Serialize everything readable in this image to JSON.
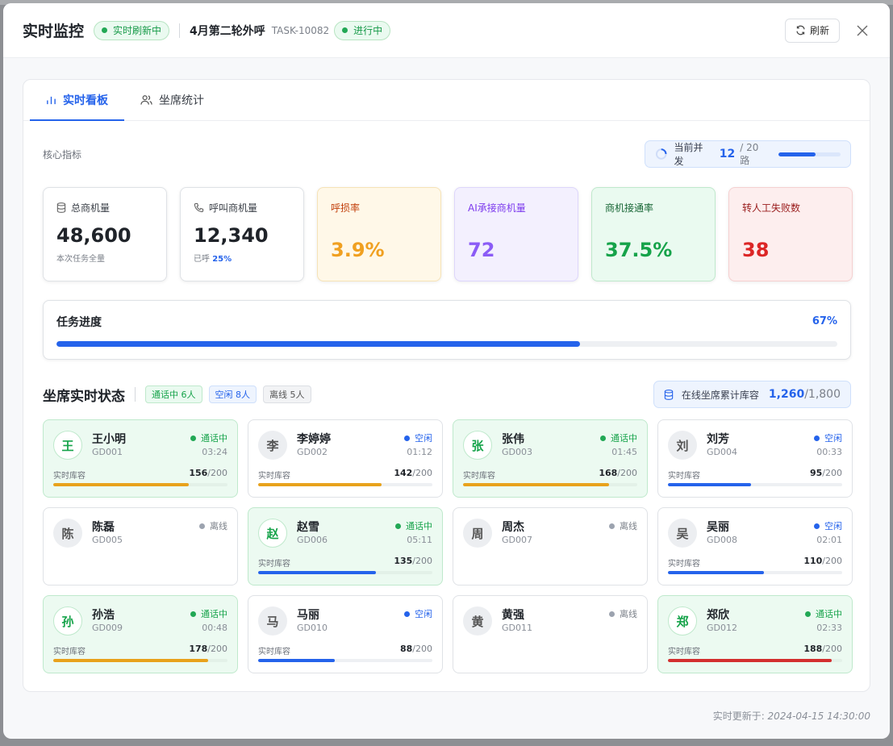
{
  "header": {
    "title": "实时监控",
    "live_pill": "实时刷新中",
    "task_name": "4月第二轮外呼",
    "task_id": "TASK-10082",
    "status_pill": "进行中",
    "refresh_label": "刷新"
  },
  "tabs": [
    {
      "label": "实时看板",
      "icon": "bar-chart-icon",
      "active": true
    },
    {
      "label": "坐席统计",
      "icon": "users-icon",
      "active": false
    }
  ],
  "core": {
    "label": "核心指标",
    "concurrency_label": "当前并发",
    "concurrency_value": "12",
    "concurrency_total": "/ 20 路",
    "concurrency_ratio": 0.6
  },
  "metrics": [
    {
      "label": "总商机量",
      "icon": "database-icon",
      "value": "48,600",
      "sub": "本次任务全量",
      "style": "plain"
    },
    {
      "label": "呼叫商机量",
      "icon": "phone-icon",
      "value": "12,340",
      "sub_prefix": "已呼 ",
      "sub_highlight": "25%",
      "style": "plain"
    },
    {
      "label": "呼损率",
      "value": "3.9%",
      "style": "orange"
    },
    {
      "label": "AI承接商机量",
      "value": "72",
      "style": "purple"
    },
    {
      "label": "商机接通率",
      "value": "37.5%",
      "style": "green"
    },
    {
      "label": "转人工失败数",
      "value": "38",
      "style": "red"
    }
  ],
  "progress": {
    "title": "任务进度",
    "percent_label": "67%",
    "percent": 67
  },
  "agents_section": {
    "title": "坐席实时状态",
    "badges": [
      {
        "text": "通话中 6人",
        "kind": "g"
      },
      {
        "text": "空闲 8人",
        "kind": "b"
      },
      {
        "text": "离线 5人",
        "kind": "n"
      }
    ],
    "capacity_label": "在线坐席累计库容",
    "capacity_value": "1,260",
    "capacity_total": "/1,800",
    "cap_label": "实时库容"
  },
  "agents": [
    {
      "surname": "王",
      "name": "王小明",
      "id": "GD001",
      "status": "通话中",
      "kind": "busy",
      "time": "03:24",
      "cap": 156,
      "max": "/200",
      "bar_color": "#e8a21c"
    },
    {
      "surname": "李",
      "name": "李婷婷",
      "id": "GD002",
      "status": "空闲",
      "kind": "idle",
      "time": "01:12",
      "cap": 142,
      "max": "/200",
      "bar_color": "#e8a21c"
    },
    {
      "surname": "张",
      "name": "张伟",
      "id": "GD003",
      "status": "通话中",
      "kind": "busy",
      "time": "01:45",
      "cap": 168,
      "max": "/200",
      "bar_color": "#e8a21c"
    },
    {
      "surname": "刘",
      "name": "刘芳",
      "id": "GD004",
      "status": "空闲",
      "kind": "idle",
      "time": "00:33",
      "cap": 95,
      "max": "/200",
      "bar_color": "#2563eb"
    },
    {
      "surname": "陈",
      "name": "陈磊",
      "id": "GD005",
      "status": "离线",
      "kind": "off",
      "time": "",
      "cap": null
    },
    {
      "surname": "赵",
      "name": "赵雪",
      "id": "GD006",
      "status": "通话中",
      "kind": "busy",
      "time": "05:11",
      "cap": 135,
      "max": "/200",
      "bar_color": "#2563eb"
    },
    {
      "surname": "周",
      "name": "周杰",
      "id": "GD007",
      "status": "离线",
      "kind": "off",
      "time": "",
      "cap": null
    },
    {
      "surname": "吴",
      "name": "吴丽",
      "id": "GD008",
      "status": "空闲",
      "kind": "idle",
      "time": "02:01",
      "cap": 110,
      "max": "/200",
      "bar_color": "#2563eb"
    },
    {
      "surname": "孙",
      "name": "孙浩",
      "id": "GD009",
      "status": "通话中",
      "kind": "busy",
      "time": "00:48",
      "cap": 178,
      "max": "/200",
      "bar_color": "#e8a21c"
    },
    {
      "surname": "马",
      "name": "马丽",
      "id": "GD010",
      "status": "空闲",
      "kind": "idle",
      "time": "",
      "cap": 88,
      "max": "/200",
      "bar_color": "#2563eb"
    },
    {
      "surname": "黄",
      "name": "黄强",
      "id": "GD011",
      "status": "离线",
      "kind": "off",
      "time": "",
      "cap": null
    },
    {
      "surname": "郑",
      "name": "郑欣",
      "id": "GD012",
      "status": "通话中",
      "kind": "busy",
      "time": "02:33",
      "cap": 188,
      "max": "/200",
      "bar_color": "#d32f2f"
    }
  ],
  "footer": {
    "prefix": "实时更新于: ",
    "time": "2024-04-15 14:30:00"
  }
}
